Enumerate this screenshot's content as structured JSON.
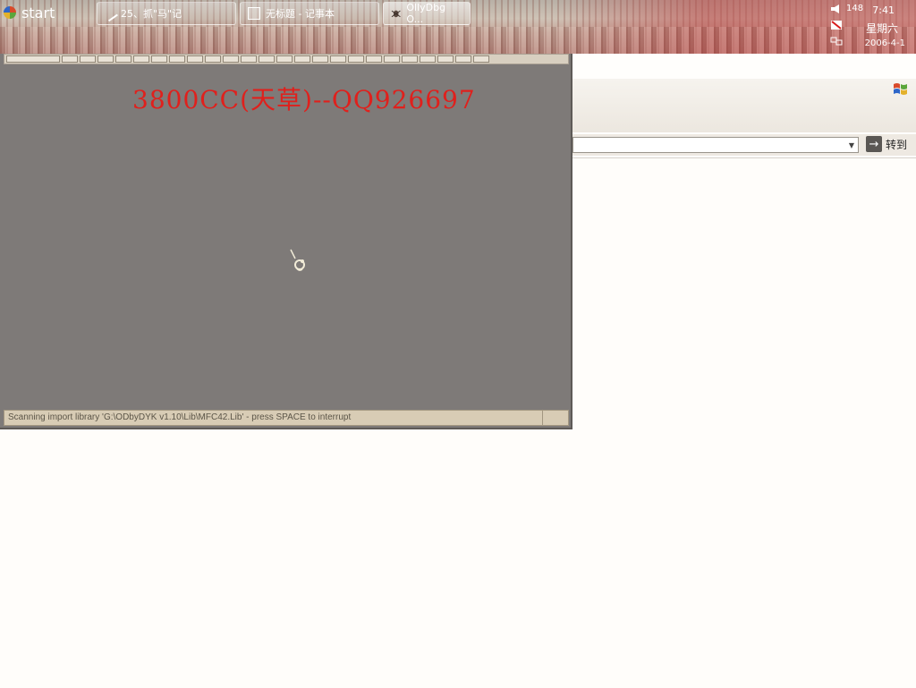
{
  "taskbar": {
    "start_label": "start",
    "buttons": [
      {
        "label": "25、抓\"马\"记",
        "icon": "pen-icon"
      },
      {
        "label": "无标题 - 记事本",
        "icon": "notepad-icon"
      },
      {
        "label": "OllyDbg O...",
        "icon": "ollydbg-bug-icon"
      }
    ],
    "tray": {
      "badge": "148",
      "time": "7:41",
      "day": "星期六",
      "date": "2006-4-1"
    }
  },
  "browser": {
    "go_label": "转到",
    "address_value": ""
  },
  "ollydbg": {
    "banner": "3800CC(天草)--QQ926697",
    "status_text": "Scanning import library 'G:\\ODbyDYK v1.10\\Lib\\MFC42.Lib' - press SPACE to interrupt"
  },
  "colors": {
    "banner_red": "#e0201c",
    "olly_background": "#7e7a78",
    "status_bar": "#d8ccb5"
  }
}
